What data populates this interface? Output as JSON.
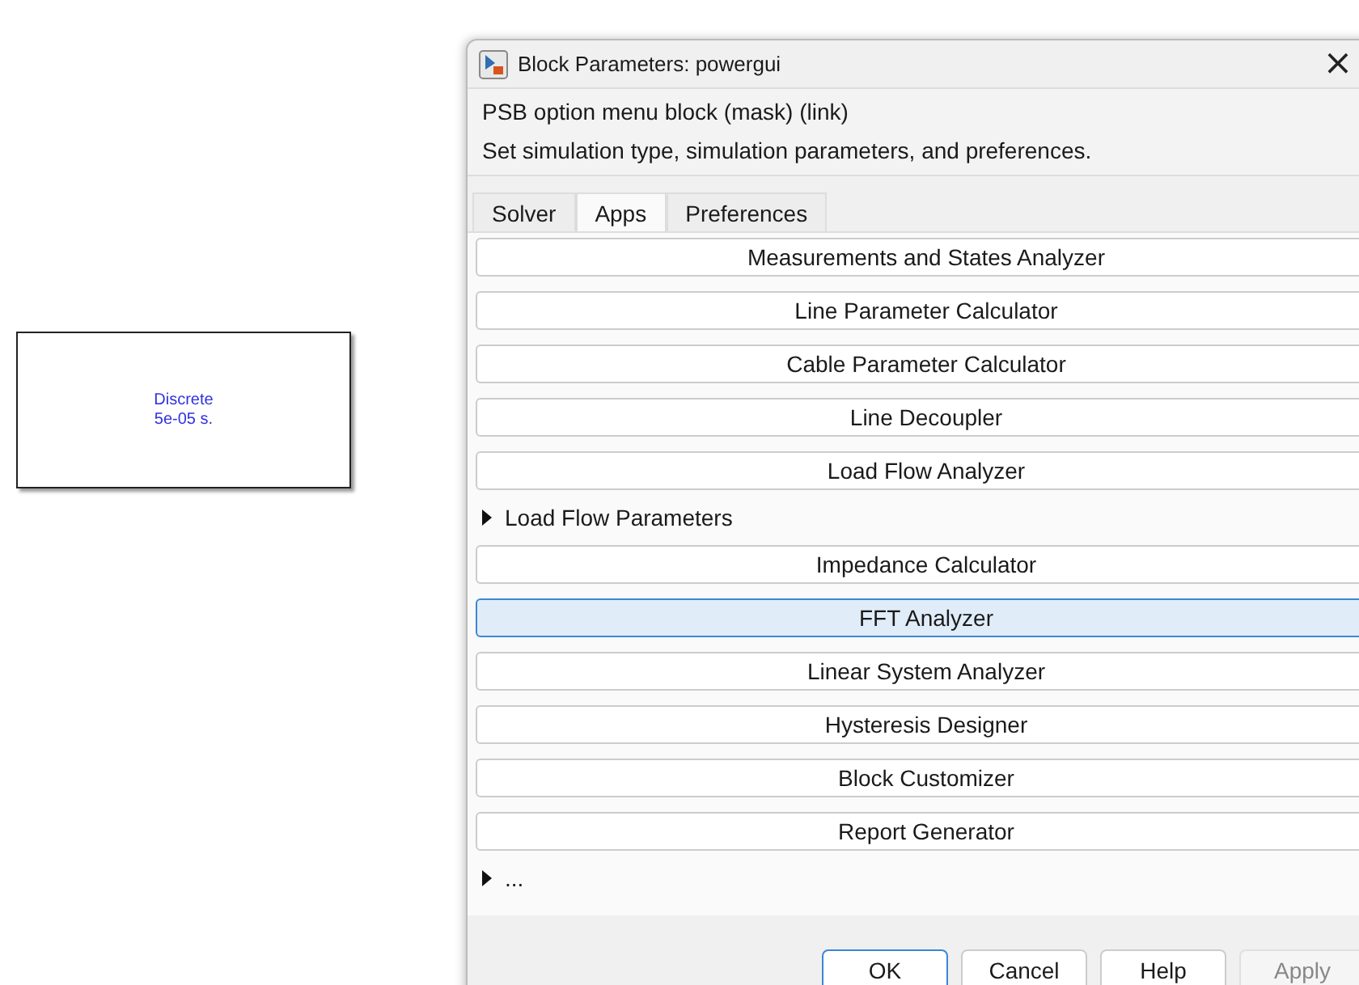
{
  "canvas_block": {
    "lines": [
      "Discrete",
      "5e-05 s."
    ]
  },
  "window": {
    "title": "Block Parameters: powergui",
    "close": "×"
  },
  "description": {
    "heading": "PSB option menu block (mask) (link)",
    "text": "Set simulation type, simulation parameters, and preferences."
  },
  "tabs": [
    {
      "label": "Solver",
      "selected": false
    },
    {
      "label": "Apps",
      "selected": true
    },
    {
      "label": "Preferences",
      "selected": false
    }
  ],
  "items": [
    {
      "kind": "button",
      "label": "Measurements and States Analyzer",
      "selected": false
    },
    {
      "kind": "button",
      "label": "Line Parameter Calculator",
      "selected": false
    },
    {
      "kind": "button",
      "label": "Cable Parameter Calculator",
      "selected": false
    },
    {
      "kind": "button",
      "label": "Line Decoupler",
      "selected": false
    },
    {
      "kind": "button",
      "label": "Load Flow Analyzer",
      "selected": false
    },
    {
      "kind": "section",
      "label": "Load Flow Parameters",
      "expanded": false
    },
    {
      "kind": "button",
      "label": "Impedance Calculator",
      "selected": false
    },
    {
      "kind": "button",
      "label": "FFT Analyzer",
      "selected": true
    },
    {
      "kind": "button",
      "label": "Linear System Analyzer",
      "selected": false
    },
    {
      "kind": "button",
      "label": "Hysteresis Designer",
      "selected": false
    },
    {
      "kind": "button",
      "label": "Block Customizer",
      "selected": false
    },
    {
      "kind": "button",
      "label": "Report Generator",
      "selected": false
    },
    {
      "kind": "section",
      "label": "...",
      "expanded": false
    }
  ],
  "buttons": [
    {
      "label": "OK",
      "default": true,
      "disabled": false
    },
    {
      "label": "Cancel",
      "default": false,
      "disabled": false
    },
    {
      "label": "Help",
      "default": false,
      "disabled": false
    },
    {
      "label": "Apply",
      "default": false,
      "disabled": true
    }
  ]
}
